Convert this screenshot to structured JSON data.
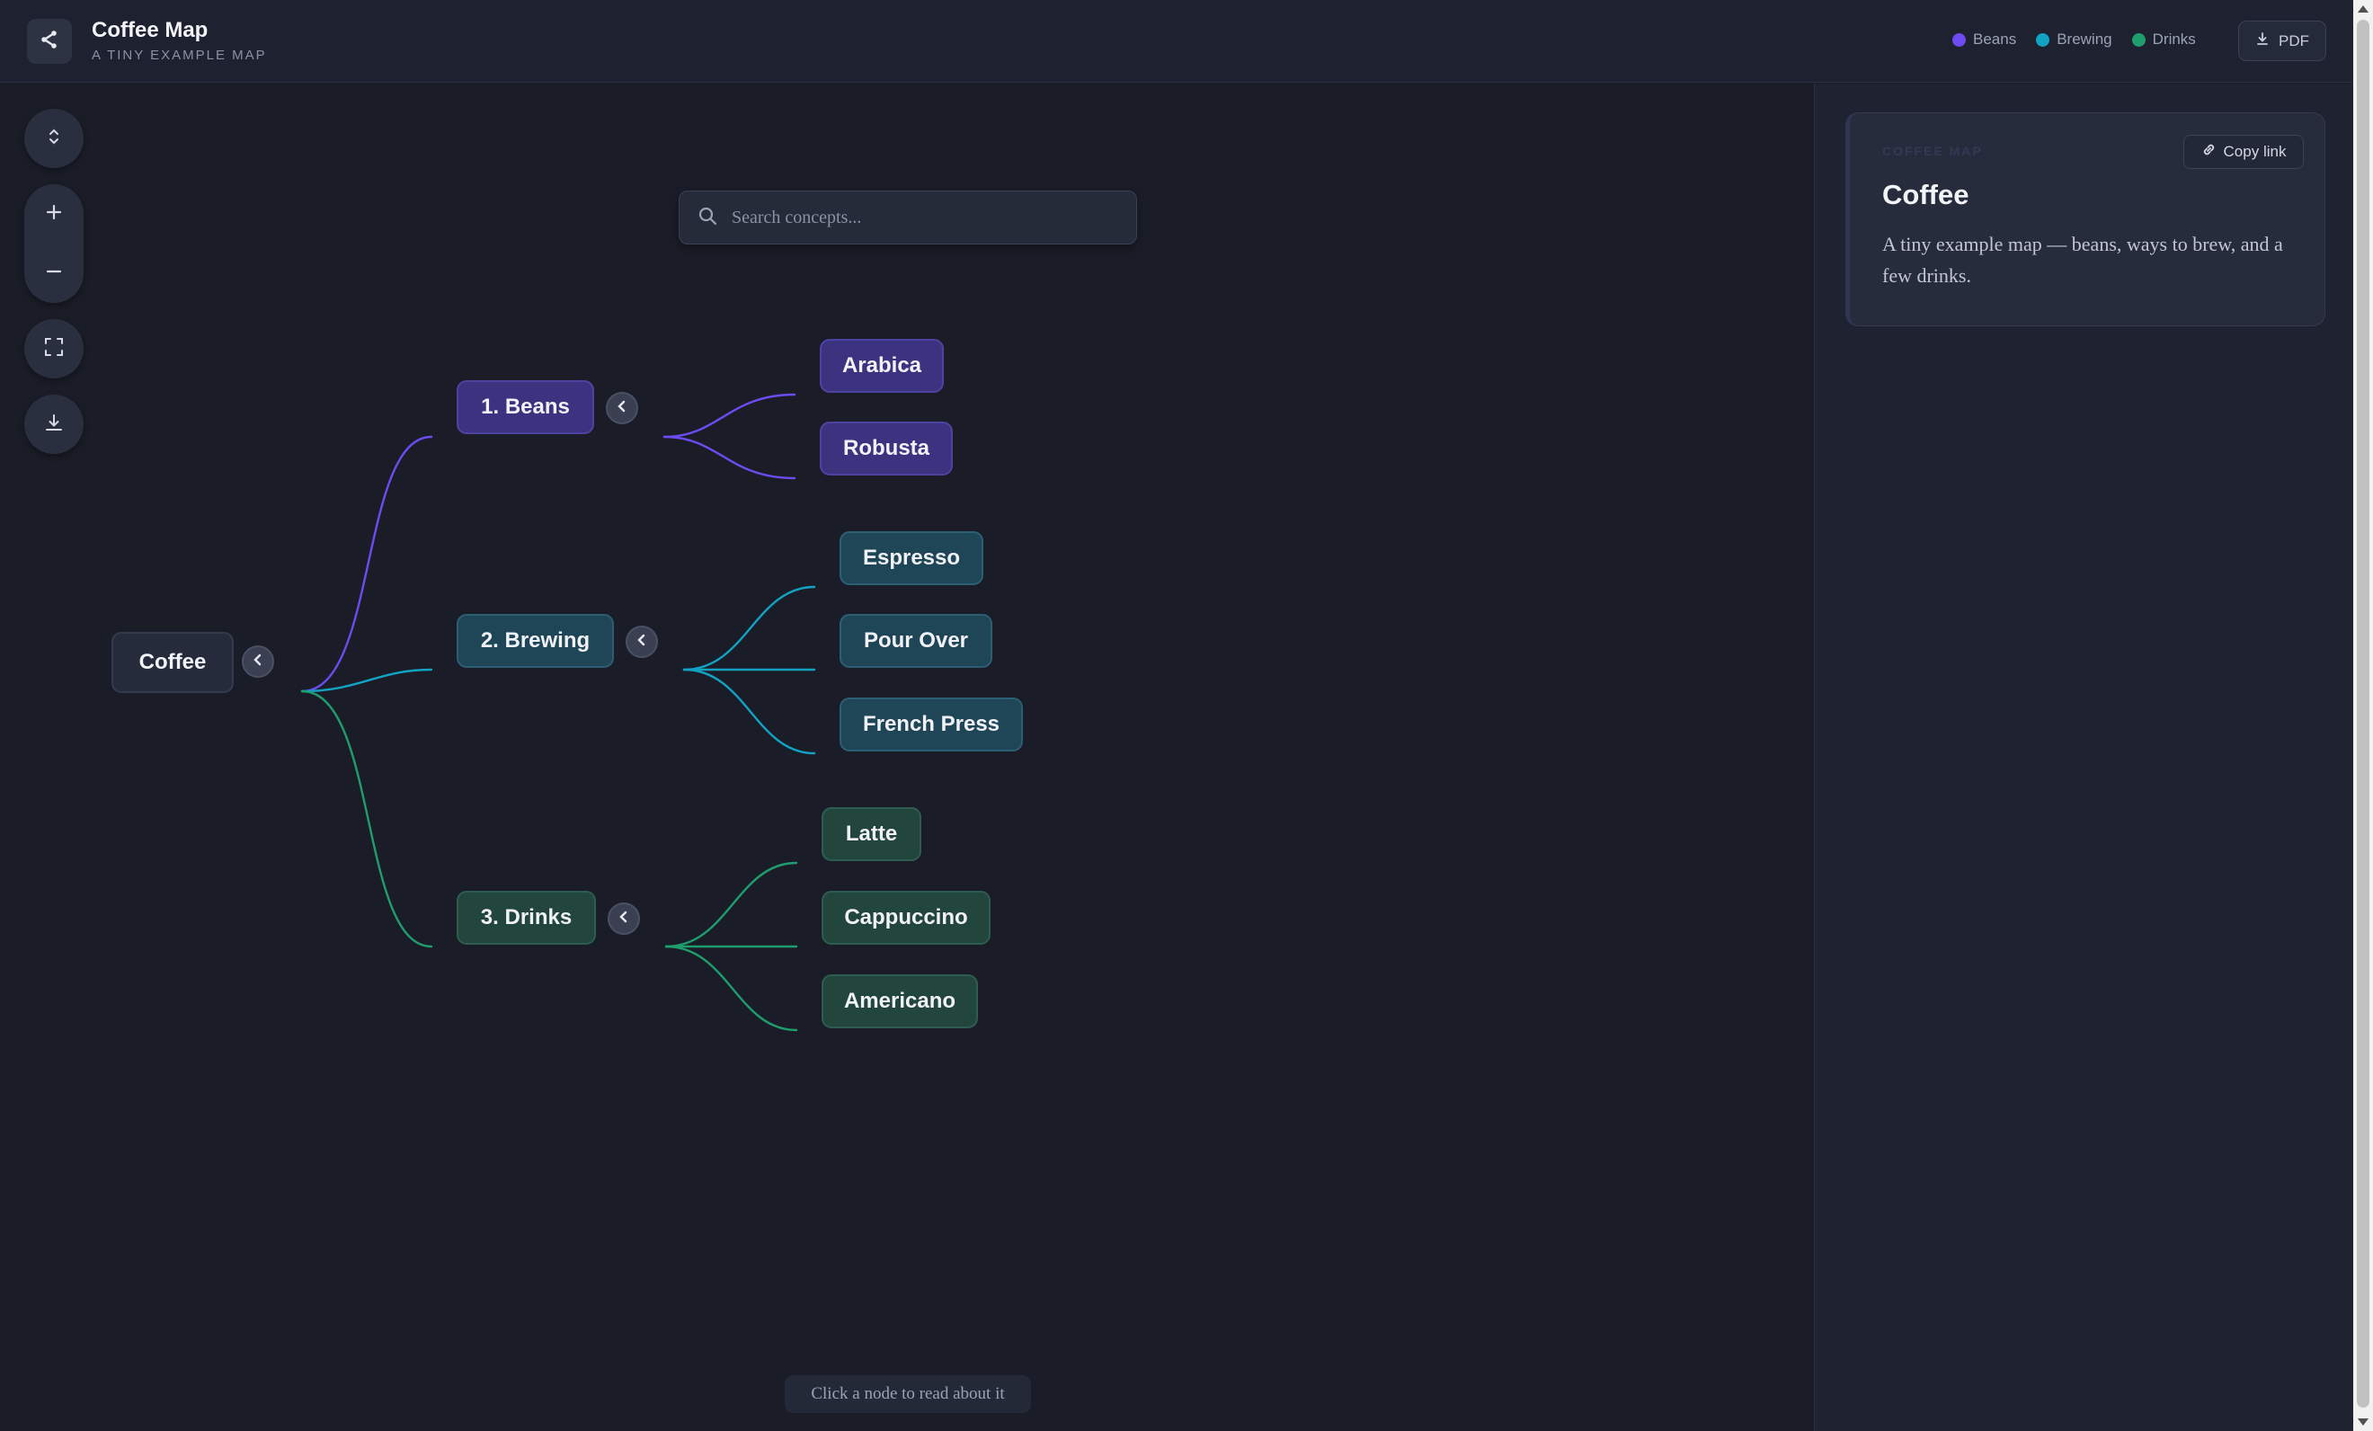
{
  "header": {
    "title": "Coffee Map",
    "subtitle": "A TINY EXAMPLE MAP",
    "legend": [
      {
        "label": "Beans",
        "color": "#6c4cf0"
      },
      {
        "label": "Brewing",
        "color": "#12a2c4"
      },
      {
        "label": "Drinks",
        "color": "#1f9d6e"
      }
    ],
    "pdf_label": "PDF",
    "icons": {
      "share": "share-icon",
      "download": "download-icon"
    }
  },
  "toolbar": {
    "icons": [
      "expand-collapse-icon",
      "zoom-in-icon",
      "zoom-out-icon",
      "fit-screen-icon",
      "download-icon"
    ]
  },
  "search": {
    "placeholder": "Search concepts..."
  },
  "map": {
    "root": "Coffee",
    "branches": [
      {
        "label": "1. Beans",
        "color": "#6c4cf0",
        "children": [
          "Arabica",
          "Robusta"
        ]
      },
      {
        "label": "2. Brewing",
        "color": "#12a2c4",
        "children": [
          "Espresso",
          "Pour Over",
          "French Press"
        ]
      },
      {
        "label": "3. Drinks",
        "color": "#1f9d6e",
        "children": [
          "Latte",
          "Cappuccino",
          "Americano"
        ]
      }
    ]
  },
  "hint": "Click a node to read about it",
  "panel": {
    "eyebrow": "COFFEE MAP",
    "copy_link_label": "Copy link",
    "title": "Coffee",
    "description": "A tiny example map — beans, ways to brew, and a few drinks."
  }
}
